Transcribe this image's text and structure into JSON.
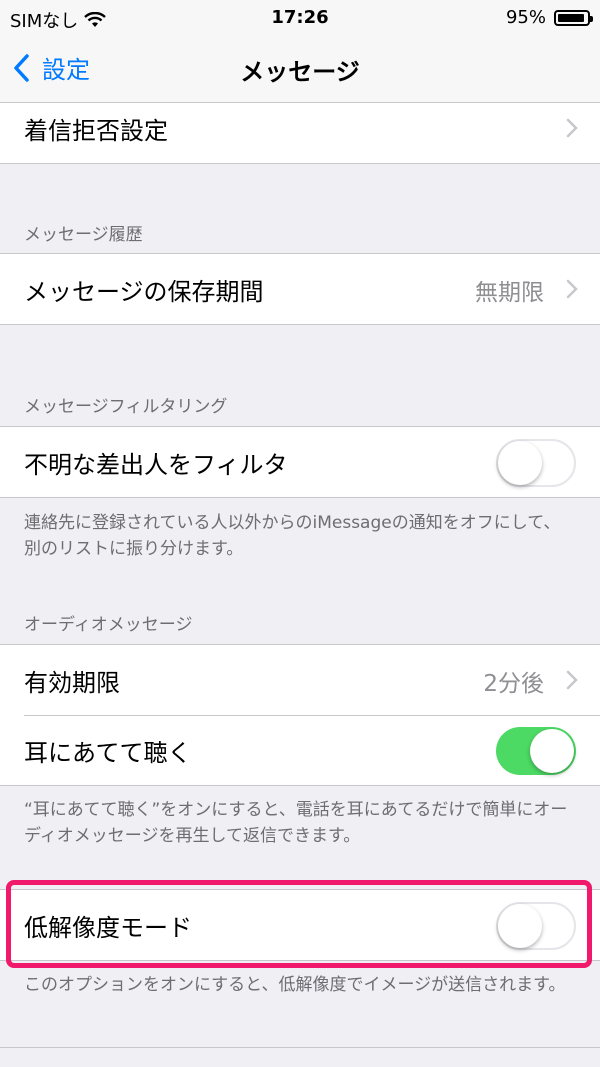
{
  "status_bar": {
    "carrier": "SIMなし",
    "time": "17:26",
    "battery": "95%"
  },
  "nav": {
    "back_label": "設定",
    "title": "メッセージ"
  },
  "rows": {
    "blocked": {
      "label": "着信拒否設定"
    },
    "keep_messages": {
      "label": "メッセージの保存期間",
      "value": "無期限"
    },
    "filter_unknown": {
      "label": "不明な差出人をフィルタ",
      "state": "off"
    },
    "expire": {
      "label": "有効期限",
      "value": "2分後"
    },
    "raise_to_listen": {
      "label": "耳にあてて聴く",
      "state": "on"
    },
    "low_quality": {
      "label": "低解像度モード",
      "state": "off"
    }
  },
  "sections": {
    "history_header": "メッセージ履歴",
    "filtering_header": "メッセージフィルタリング",
    "filtering_footer": "連絡先に登録されている人以外からのiMessageの通知をオフにして、別のリストに振り分けます。",
    "audio_header": "オーディオメッセージ",
    "audio_footer": "“耳にあてて聴く”をオンにすると、電話を耳にあてるだけで簡単にオーディオメッセージを再生して返信できます。",
    "low_quality_footer": "このオプションをオンにすると、低解像度でイメージが送信されます。"
  },
  "colors": {
    "accent": "#007aff",
    "toggle_on": "#4cd964",
    "highlight": "#f0196b"
  }
}
